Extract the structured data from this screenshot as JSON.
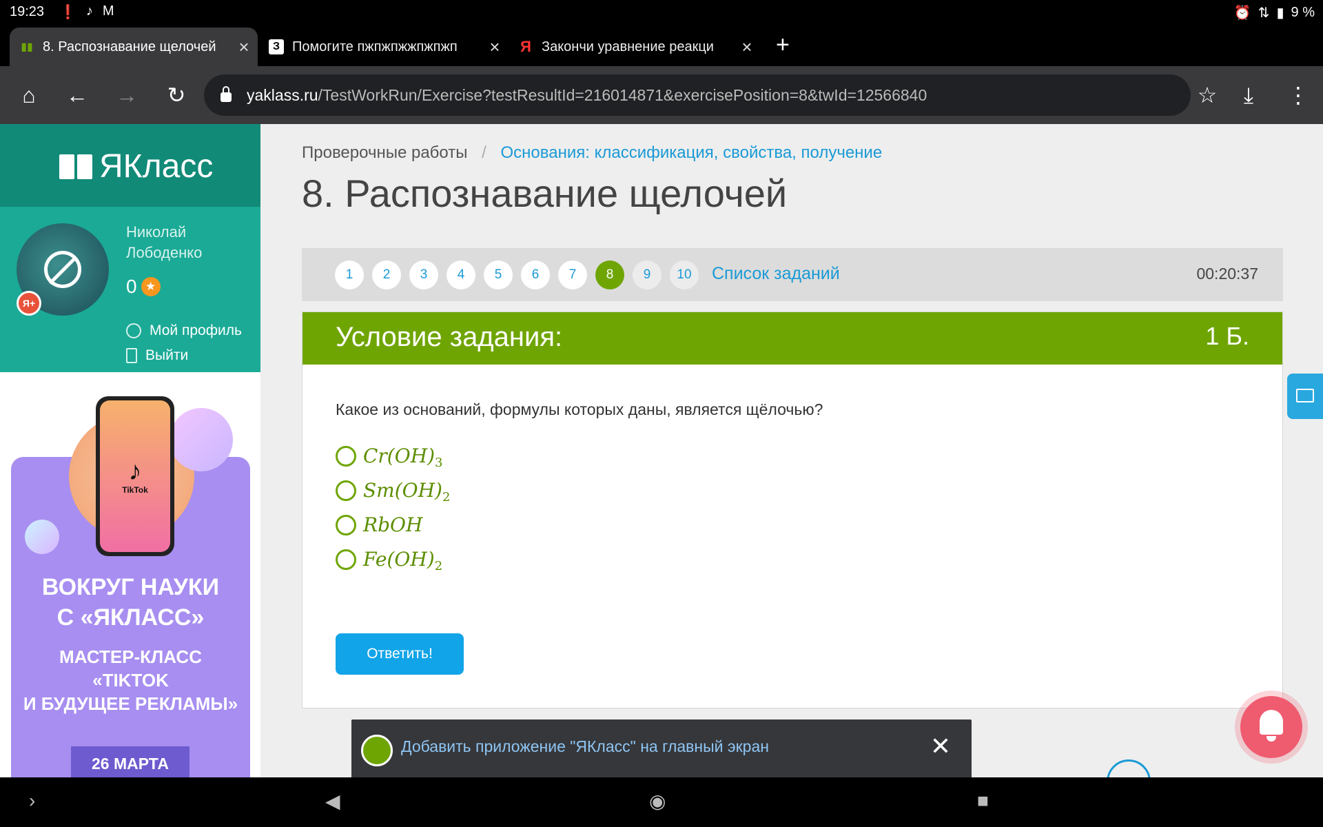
{
  "status": {
    "time": "19:23",
    "battery": "9 %"
  },
  "tabs": [
    {
      "title": "8. Распознавание щелочей",
      "favicon": "📗",
      "active": true
    },
    {
      "title": "Помогите пжпжпжжпжпжп",
      "favicon": "З",
      "active": false
    },
    {
      "title": "Закончи уравнение реакци",
      "favicon": "Я",
      "active": false
    }
  ],
  "toolbar": {
    "url_domain": "yaklass.ru",
    "url_path": "/TestWorkRun/Exercise?testResultId=216014871&exercisePosition=8&twId=12566840"
  },
  "sidebar": {
    "logo": "ЯКласс",
    "user_first": "Николай",
    "user_last": "Лободенко",
    "score": "0",
    "profile_link": "Мой профиль",
    "logout_link": "Выйти",
    "ya_badge": "Я+"
  },
  "ad": {
    "phone_label": "TikTok",
    "headline_1": "ВОКРУГ НАУКИ",
    "headline_2": "С «ЯКЛАСС»",
    "sub_1": "МАСТЕР-КЛАСС",
    "sub_2": "«TIKTOK",
    "sub_3": "И БУДУЩЕЕ РЕКЛАМЫ»",
    "date": "26 МАРТА"
  },
  "breadcrumb": {
    "root": "Проверочные работы",
    "separator": "/",
    "current": "Основания: классификация, свойства, получение"
  },
  "page_title": "8. Распознавание щелочей",
  "pager": {
    "items": [
      "1",
      "2",
      "3",
      "4",
      "5",
      "6",
      "7",
      "8",
      "9",
      "10"
    ],
    "current": "8",
    "tasks_link": "Список заданий",
    "timer": "00:20:37"
  },
  "task": {
    "header": "Условие задания:",
    "points": "1 Б.",
    "question": "Какое из оснований, формулы которых даны, является щёлочью?",
    "options": [
      {
        "base": "Cr(OH)",
        "sub": "3"
      },
      {
        "base": "Sm(OH)",
        "sub": "2"
      },
      {
        "base": "RbOH",
        "sub": ""
      },
      {
        "base": "Fe(OH)",
        "sub": "2"
      }
    ],
    "submit": "Ответить!"
  },
  "snackbar": {
    "text": "Добавить приложение \"ЯКласс\" на главный экран",
    "close": "✕"
  },
  "colors": {
    "brand_teal": "#128a78",
    "accent_green": "#6fa503",
    "link_blue": "#1a9ad6",
    "button_blue": "#12a4e8"
  }
}
